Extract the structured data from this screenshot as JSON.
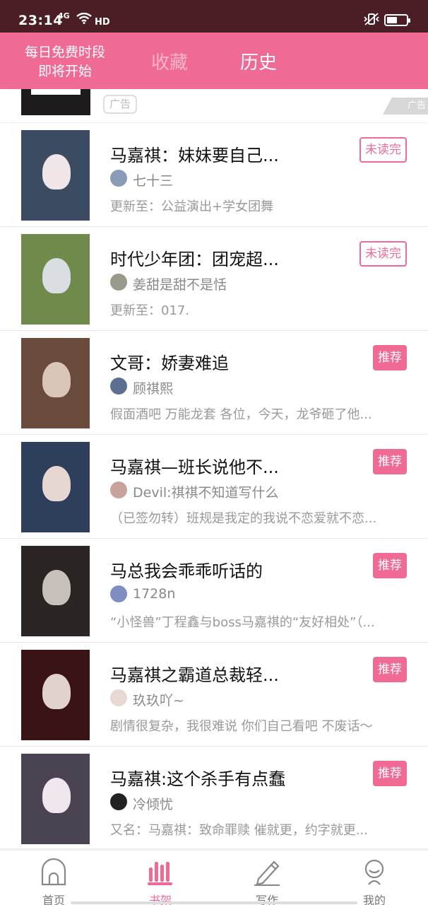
{
  "status": {
    "time": "23:14",
    "net": "4G",
    "hd": "HD",
    "battery_level": 0.55
  },
  "header": {
    "promo_line1": "每日免费时段",
    "promo_line2": "即将开始",
    "tab_favorites": "收藏",
    "tab_history": "历史"
  },
  "ad": {
    "label": "广告",
    "corner": "广告"
  },
  "books": [
    {
      "title": "马嘉祺：妹妹要自己...",
      "author": "七十三",
      "desc": "更新至：公益演出+学女团舞",
      "badge": "未读完",
      "badge_type": "unread",
      "cover_bg": "#3b4b62",
      "cover_fig": "#f0e6e8",
      "avatar": "#8a9bb8"
    },
    {
      "title": "时代少年团：团宠超...",
      "author": "姜甜是甜不是恬",
      "desc": "更新至：017.",
      "badge": "未读完",
      "badge_type": "unread",
      "cover_bg": "#6f8a4a",
      "cover_fig": "#d9dde2",
      "avatar": "#9a9a8c"
    },
    {
      "title": "文哥：娇妻难追",
      "author": "顾祺熙",
      "desc": "假面酒吧 万能龙套 各位，今天，龙爷砸了他...",
      "badge": "推荐",
      "badge_type": "rec",
      "cover_bg": "#6b4b3c",
      "cover_fig": "#d9c6b8",
      "avatar": "#5d6f90"
    },
    {
      "title": "马嘉祺—班长说他不...",
      "author": "Devil:祺祺不知道写什么",
      "desc": "（已签勿转）班规是我定的我说不恋爱就不恋...",
      "badge": "推荐",
      "badge_type": "rec",
      "cover_bg": "#2d3f5a",
      "cover_fig": "#e6d8d0",
      "avatar": "#c9a39b"
    },
    {
      "title": "马总我会乖乖听话的",
      "author": "1728n",
      "desc": "“小怪兽”丁程鑫与boss马嘉祺的“友好相处”（...",
      "badge": "推荐",
      "badge_type": "rec",
      "cover_bg": "#2a2422",
      "cover_fig": "#c8c0ba",
      "avatar": "#7d8fc0"
    },
    {
      "title": "马嘉祺之霸道总裁轻...",
      "author": "玖玖吖~",
      "desc": "剧情很复杂，我很难说 你们自己看吧 不废话～",
      "badge": "推荐",
      "badge_type": "rec",
      "cover_bg": "#3a1414",
      "cover_fig": "#e2d2cc",
      "avatar": "#e9d8d2"
    },
    {
      "title": "马嘉祺:这个杀手有点蠢",
      "author": "冷倾忧",
      "desc": "又名：马嘉祺：致命罪赎 催就更，约字就更...",
      "badge": "推荐",
      "badge_type": "rec",
      "cover_bg": "#4a4452",
      "cover_fig": "#efe6ee",
      "avatar": "#222222"
    }
  ],
  "nav": {
    "home": "首页",
    "shelf": "书架",
    "write": "写作",
    "me": "我的"
  },
  "colors": {
    "accent": "#f06b93",
    "statusbar": "#4a1e24"
  }
}
